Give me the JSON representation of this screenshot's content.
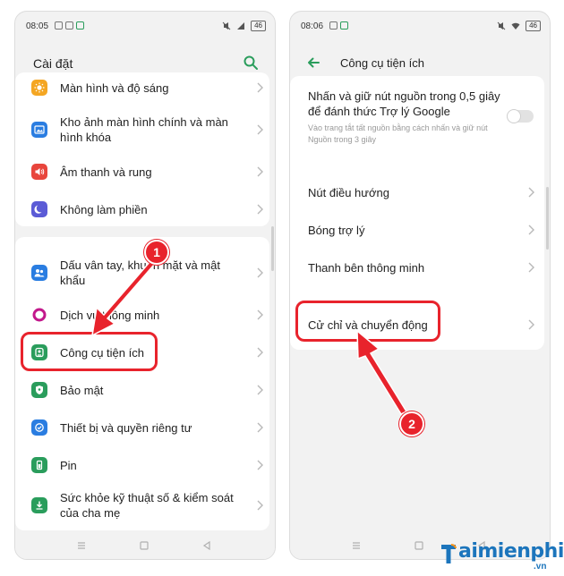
{
  "left_screen": {
    "status": {
      "time": "08:05",
      "battery": "46"
    },
    "title": "Cài đặt",
    "items": [
      {
        "label": "Màn hình và độ sáng",
        "icon": "brightness-icon",
        "color": "#f4a623"
      },
      {
        "label": "Kho ảnh màn hình chính và màn hình khóa",
        "icon": "wallpaper-icon",
        "color": "#2a7de1"
      },
      {
        "label": "Âm thanh và rung",
        "icon": "speaker-icon",
        "color": "#e8453c"
      },
      {
        "label": "Không làm phiền",
        "icon": "moon-icon",
        "color": "#5b5bd6"
      },
      {
        "label": "Dấu vân tay, khuôn mặt và mật khẩu",
        "icon": "people-icon",
        "color": "#2a7de1"
      },
      {
        "label": "Dịch vụ thông minh",
        "icon": "smart-service-icon",
        "color": "#c2188b"
      },
      {
        "label": "Công cụ tiện ích",
        "icon": "tools-icon",
        "color": "#2a9d5c"
      },
      {
        "label": "Bảo mật",
        "icon": "shield-icon",
        "color": "#2a9d5c"
      },
      {
        "label": "Thiết bị và quyền riêng tư",
        "icon": "privacy-icon",
        "color": "#2a7de1"
      },
      {
        "label": "Pin",
        "icon": "battery-icon",
        "color": "#2a9d5c"
      },
      {
        "label": "Sức khỏe kỹ thuật số & kiểm soát của cha mẹ",
        "icon": "wellbeing-icon",
        "color": "#2a9d5c"
      }
    ]
  },
  "right_screen": {
    "status": {
      "time": "08:06",
      "battery": "46"
    },
    "title": "Công cụ tiện ích",
    "power_item": {
      "label": "Nhấn và giữ nút nguồn trong 0,5 giây để đánh thức Trợ lý Google",
      "sub": "Vào trang tắt tất nguồn bằng cách nhấn và giữ nút Nguồn trong 3 giây",
      "toggle_on": false
    },
    "items": [
      {
        "label": "Nút điều hướng"
      },
      {
        "label": "Bóng trợ lý"
      },
      {
        "label": "Thanh bên thông minh"
      },
      {
        "label": "Cử chỉ và chuyển động"
      }
    ]
  },
  "annotations": {
    "step1": "1",
    "step2": "2",
    "highlight_color": "#e8232c"
  },
  "watermark": {
    "brand": "Taimienphi",
    "brand_rest": "aimienphi",
    "tld": ".vn"
  }
}
